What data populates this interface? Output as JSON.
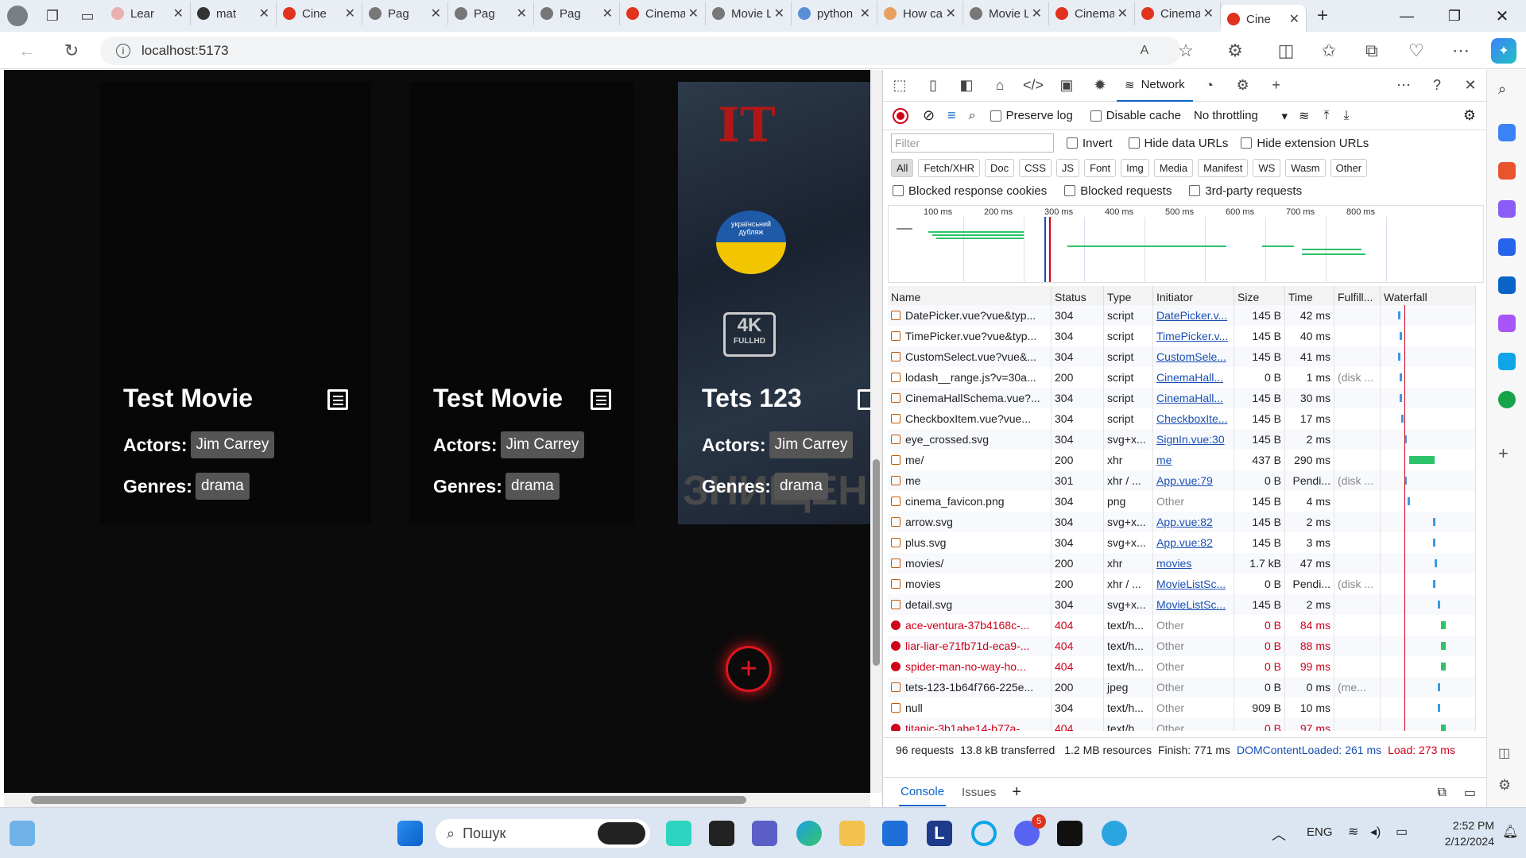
{
  "browser": {
    "tabs": [
      {
        "title": "Lear",
        "color": "#e9b0b0"
      },
      {
        "title": "mat",
        "color": "#333333"
      },
      {
        "title": "Cine",
        "color": "#e0321d"
      },
      {
        "title": "Pag",
        "color": "#777777"
      },
      {
        "title": "Pag",
        "color": "#777777"
      },
      {
        "title": "Pag",
        "color": "#777777"
      },
      {
        "title": "Cinema S",
        "color": "#e0321d"
      },
      {
        "title": "Movie Li",
        "color": "#777777"
      },
      {
        "title": "python lc",
        "color": "#5a8fd8"
      },
      {
        "title": "How can",
        "color": "#e8a060"
      },
      {
        "title": "Movie Li",
        "color": "#777777"
      },
      {
        "title": "Cinema S",
        "color": "#e0321d"
      },
      {
        "title": "Cinema S",
        "color": "#e0321d"
      },
      {
        "title": "Cine",
        "color": "#e0321d"
      }
    ],
    "url": "localhost:5173"
  },
  "page": {
    "cards": [
      {
        "title": "Test Movie",
        "actors_label": "Actors:",
        "actor": "Jim Carrey",
        "genres_label": "Genres:",
        "genre": "drama"
      },
      {
        "title": "Test Movie",
        "actors_label": "Actors:",
        "actor": "Jim Carrey",
        "genres_label": "Genres:",
        "genre": "drama"
      },
      {
        "title": "Tets 123",
        "actors_label": "Actors:",
        "actor": "Jim Carrey",
        "genres_label": "Genres:",
        "genre": "drama"
      }
    ],
    "poster_text": {
      "big": "IT",
      "badge": "українсьний дубляж",
      "res": "4K",
      "res_sub": "FULLHD",
      "bottom": "ЗНИЩЕН"
    },
    "add_label": "+"
  },
  "devtools": {
    "network_tab": "Network",
    "preserve_log": "Preserve log",
    "disable_cache": "Disable cache",
    "throttling": "No throttling",
    "filter_placeholder": "Filter",
    "invert": "Invert",
    "hide_data_urls": "Hide data URLs",
    "hide_ext_urls": "Hide extension URLs",
    "types": [
      "All",
      "Fetch/XHR",
      "Doc",
      "CSS",
      "JS",
      "Font",
      "Img",
      "Media",
      "Manifest",
      "WS",
      "Wasm",
      "Other"
    ],
    "blocked_cookies": "Blocked response cookies",
    "blocked_requests": "Blocked requests",
    "third_party": "3rd-party requests",
    "ticks": [
      "100 ms",
      "200 ms",
      "300 ms",
      "400 ms",
      "500 ms",
      "600 ms",
      "700 ms",
      "800 ms"
    ],
    "columns": [
      "Name",
      "Status",
      "Type",
      "Initiator",
      "Size",
      "Time",
      "Fulfill...",
      "Waterfall"
    ],
    "rows": [
      {
        "name": "DatePicker.vue?vue&typ...",
        "status": "304",
        "type": "script",
        "initiator": "DatePicker.v...",
        "size": "145 B",
        "time": "42 ms",
        "fulfill": "",
        "err": false,
        "link": true
      },
      {
        "name": "TimePicker.vue?vue&typ...",
        "status": "304",
        "type": "script",
        "initiator": "TimePicker.v...",
        "size": "145 B",
        "time": "40 ms",
        "fulfill": "",
        "err": false,
        "link": true
      },
      {
        "name": "CustomSelect.vue?vue&...",
        "status": "304",
        "type": "script",
        "initiator": "CustomSele...",
        "size": "145 B",
        "time": "41 ms",
        "fulfill": "",
        "err": false,
        "link": true
      },
      {
        "name": "lodash__range.js?v=30a...",
        "status": "200",
        "type": "script",
        "initiator": "CinemaHall...",
        "size": "0 B",
        "time": "1 ms",
        "fulfill": "(disk ...",
        "err": false,
        "link": true
      },
      {
        "name": "CinemaHallSchema.vue?...",
        "status": "304",
        "type": "script",
        "initiator": "CinemaHall...",
        "size": "145 B",
        "time": "30 ms",
        "fulfill": "",
        "err": false,
        "link": true
      },
      {
        "name": "CheckboxItem.vue?vue...",
        "status": "304",
        "type": "script",
        "initiator": "CheckboxIte...",
        "size": "145 B",
        "time": "17 ms",
        "fulfill": "",
        "err": false,
        "link": true
      },
      {
        "name": "eye_crossed.svg",
        "status": "304",
        "type": "svg+x...",
        "initiator": "SignIn.vue:30",
        "size": "145 B",
        "time": "2 ms",
        "fulfill": "",
        "err": false,
        "link": true
      },
      {
        "name": "me/",
        "status": "200",
        "type": "xhr",
        "initiator": "me",
        "size": "437 B",
        "time": "290 ms",
        "fulfill": "",
        "err": false,
        "link": true
      },
      {
        "name": "me",
        "status": "301",
        "type": "xhr / ...",
        "initiator": "App.vue:79",
        "size": "0 B",
        "time": "Pendi...",
        "fulfill": "(disk ...",
        "err": false,
        "link": true
      },
      {
        "name": "cinema_favicon.png",
        "status": "304",
        "type": "png",
        "initiator": "Other",
        "size": "145 B",
        "time": "4 ms",
        "fulfill": "",
        "err": false,
        "link": false
      },
      {
        "name": "arrow.svg",
        "status": "304",
        "type": "svg+x...",
        "initiator": "App.vue:82",
        "size": "145 B",
        "time": "2 ms",
        "fulfill": "",
        "err": false,
        "link": true
      },
      {
        "name": "plus.svg",
        "status": "304",
        "type": "svg+x...",
        "initiator": "App.vue:82",
        "size": "145 B",
        "time": "3 ms",
        "fulfill": "",
        "err": false,
        "link": true
      },
      {
        "name": "movies/",
        "status": "200",
        "type": "xhr",
        "initiator": "movies",
        "size": "1.7 kB",
        "time": "47 ms",
        "fulfill": "",
        "err": false,
        "link": true
      },
      {
        "name": "movies",
        "status": "200",
        "type": "xhr / ...",
        "initiator": "MovieListSc...",
        "size": "0 B",
        "time": "Pendi...",
        "fulfill": "(disk ...",
        "err": false,
        "link": true
      },
      {
        "name": "detail.svg",
        "status": "304",
        "type": "svg+x...",
        "initiator": "MovieListSc...",
        "size": "145 B",
        "time": "2 ms",
        "fulfill": "",
        "err": false,
        "link": true
      },
      {
        "name": "ace-ventura-37b4168c-...",
        "status": "404",
        "type": "text/h...",
        "initiator": "Other",
        "size": "0 B",
        "time": "84 ms",
        "fulfill": "",
        "err": true,
        "link": false
      },
      {
        "name": "liar-liar-e71fb71d-eca9-...",
        "status": "404",
        "type": "text/h...",
        "initiator": "Other",
        "size": "0 B",
        "time": "88 ms",
        "fulfill": "",
        "err": true,
        "link": false
      },
      {
        "name": "spider-man-no-way-ho...",
        "status": "404",
        "type": "text/h...",
        "initiator": "Other",
        "size": "0 B",
        "time": "99 ms",
        "fulfill": "",
        "err": true,
        "link": false
      },
      {
        "name": "tets-123-1b64f766-225e...",
        "status": "200",
        "type": "jpeg",
        "initiator": "Other",
        "size": "0 B",
        "time": "0 ms",
        "fulfill": "(me...",
        "err": false,
        "link": false
      },
      {
        "name": "null",
        "status": "304",
        "type": "text/h...",
        "initiator": "Other",
        "size": "909 B",
        "time": "10 ms",
        "fulfill": "",
        "err": false,
        "link": false
      },
      {
        "name": "titanic-3b1abe14-b77a-...",
        "status": "404",
        "type": "text/h...",
        "initiator": "Other",
        "size": "0 B",
        "time": "97 ms",
        "fulfill": "",
        "err": true,
        "link": false
      }
    ],
    "summary": {
      "requests": "96 requests",
      "transferred": "13.8 kB transferred",
      "resources": "1.2 MB resources",
      "finish": "Finish: 771 ms",
      "dcl": "DOMContentLoaded: 261 ms",
      "load": "Load: 273 ms"
    },
    "drawer": {
      "console": "Console",
      "issues": "Issues"
    }
  },
  "taskbar": {
    "search": "Пошук",
    "lang": "ENG",
    "time": "2:52 PM",
    "date": "2/12/2024",
    "badge": "5"
  }
}
